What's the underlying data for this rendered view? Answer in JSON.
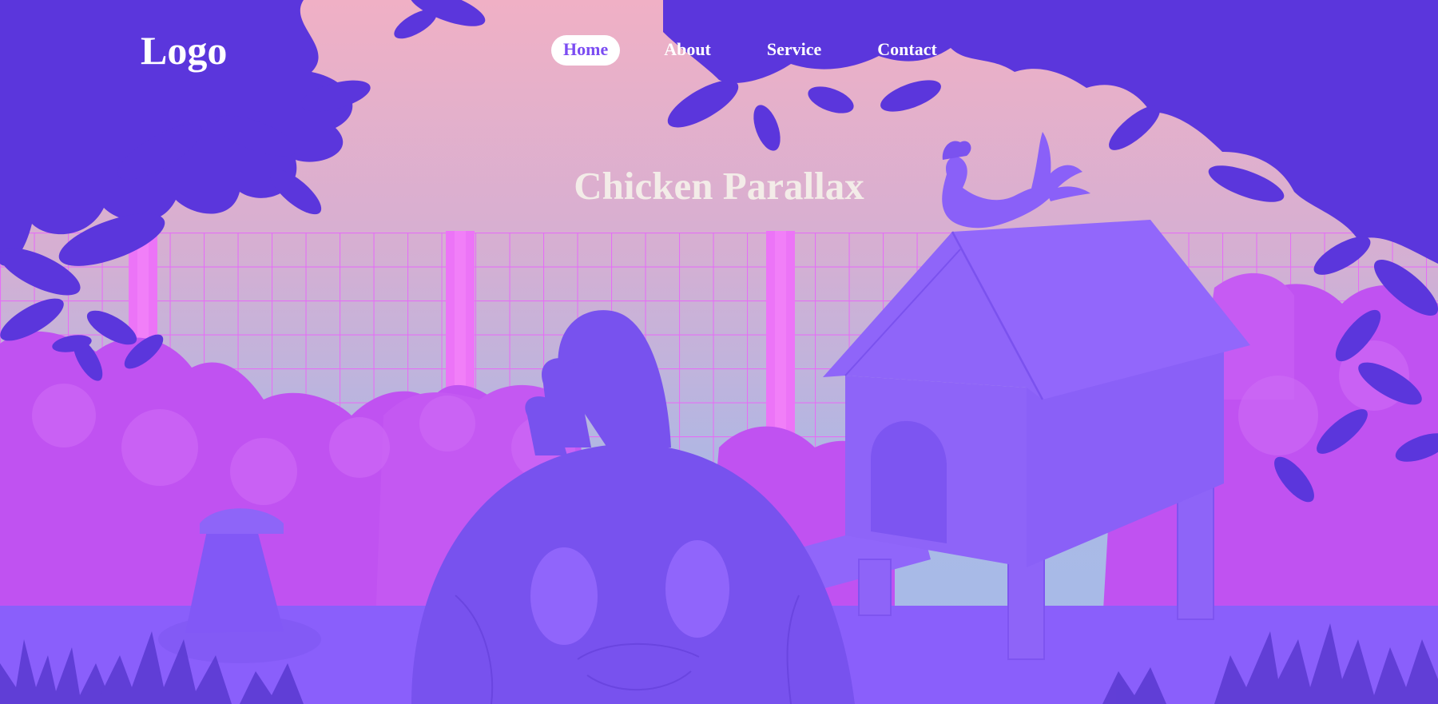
{
  "header": {
    "logo": "Logo",
    "nav": [
      {
        "label": "Home",
        "active": true
      },
      {
        "label": "About",
        "active": false
      },
      {
        "label": "Service",
        "active": false
      },
      {
        "label": "Contact",
        "active": false
      }
    ]
  },
  "hero": {
    "title": "Chicken Parallax"
  },
  "colors": {
    "sky_top": "#efb1c6",
    "sky_bottom": "#a9b8e6",
    "foliage": "#5a35db",
    "bushes": "#c356f2",
    "fence": "#e271f7",
    "ground": "#8a5ffb",
    "chicken": "#7a50ee",
    "coop": "#8d63fb",
    "accent": "#7b4cf2"
  }
}
